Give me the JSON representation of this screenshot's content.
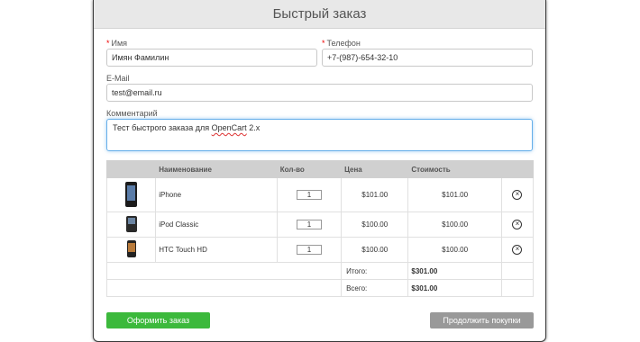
{
  "modal": {
    "title": "Быстрый заказ"
  },
  "form": {
    "name_label": "Имя",
    "name_value": "Имян Фамилин",
    "phone_label": "Телефон",
    "phone_value": "+7-(987)-654-32-10",
    "email_label": "E-Mail",
    "email_value": "test@email.ru",
    "comment_label": "Комментарий",
    "comment_prefix": "Тест быстрого заказа для ",
    "comment_misspelled": "OpenCart",
    "comment_suffix": " 2.x"
  },
  "table": {
    "headers": [
      "Наименование",
      "Кол-во",
      "Цена",
      "Стоимость"
    ],
    "rows": [
      {
        "image_icon": "iphone-icon",
        "name": "iPhone",
        "qty": "1",
        "price": "$101.00",
        "total": "$101.00"
      },
      {
        "image_icon": "ipod-icon",
        "name": "iPod Classic",
        "qty": "1",
        "price": "$100.00",
        "total": "$100.00"
      },
      {
        "image_icon": "htc-phone-icon",
        "name": "HTC Touch HD",
        "qty": "1",
        "price": "$100.00",
        "total": "$100.00"
      }
    ],
    "summary": [
      {
        "label": "Итого:",
        "value": "$301.00"
      },
      {
        "label": "Всего:",
        "value": "$301.00"
      }
    ],
    "remove_icon": "remove-circle-icon"
  },
  "buttons": {
    "checkout": "Оформить заказ",
    "continue": "Продолжить покупки"
  },
  "colors": {
    "checkout": "#3cb93c",
    "continue": "#999999",
    "focus": "#66afe9",
    "required": "#e00000"
  }
}
